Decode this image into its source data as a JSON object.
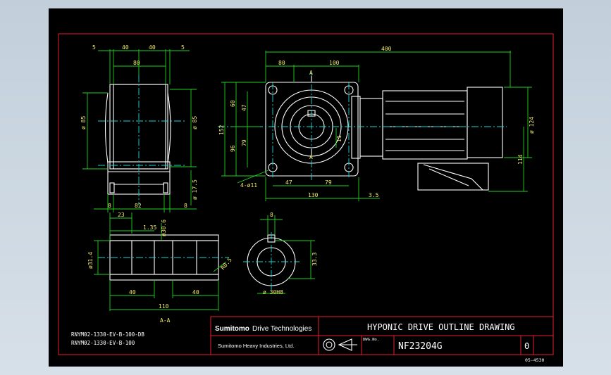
{
  "dims": {
    "top": [
      "5",
      "40",
      "40",
      "5"
    ],
    "top_sub": "80",
    "left_d1": "ø 85",
    "right_d1": "ø 85",
    "bottom": [
      "8",
      "82",
      "8"
    ],
    "shaft_d": "ø 17.5",
    "fv_top_total": "400",
    "fv_top": [
      "80",
      "100"
    ],
    "fv_left": [
      "60",
      "47",
      "96",
      "79"
    ],
    "fv_height": "152",
    "fv_inner": "11",
    "fv_bottom": [
      "47",
      "79"
    ],
    "fv_bottom_total": "130",
    "fv_offset": "3.5",
    "hole": "4-ø11",
    "motor_d": "ø 124",
    "motor_h": "114",
    "section_mark": "A",
    "sv_top": "23",
    "sv_135": "1.35",
    "sv_d30": "ø30.6",
    "sv_d31": "ø31.4",
    "sv_r": "R0.5",
    "sv_bottom": [
      "40",
      "40"
    ],
    "sv_total": "110",
    "kw_top": "8",
    "kw_side": "33.3",
    "kw_d": "ø 30H8",
    "section_label": "A-A"
  },
  "model_lines": [
    "RNYM02-1330-EV-B-100-DB",
    "RNYM02-1330-EV-B-100"
  ],
  "title_block": {
    "brand_main": "Sumitomo",
    "brand_sub": "Drive Technologies",
    "brand_line2": "Sumitomo Heavy Industries, Ltd.",
    "title": "HYPONIC DRIVE OUTLINE DRAWING",
    "dwg_label": "DWG.No.",
    "dwg_no": "NF23204G",
    "rev": "0",
    "footer": "05-4530"
  },
  "colors": {
    "outline": "#ffffff",
    "dimension": "#1fd11f",
    "border": "#e8202a",
    "center": "#1ad6d6",
    "text": "#f4e96b"
  }
}
